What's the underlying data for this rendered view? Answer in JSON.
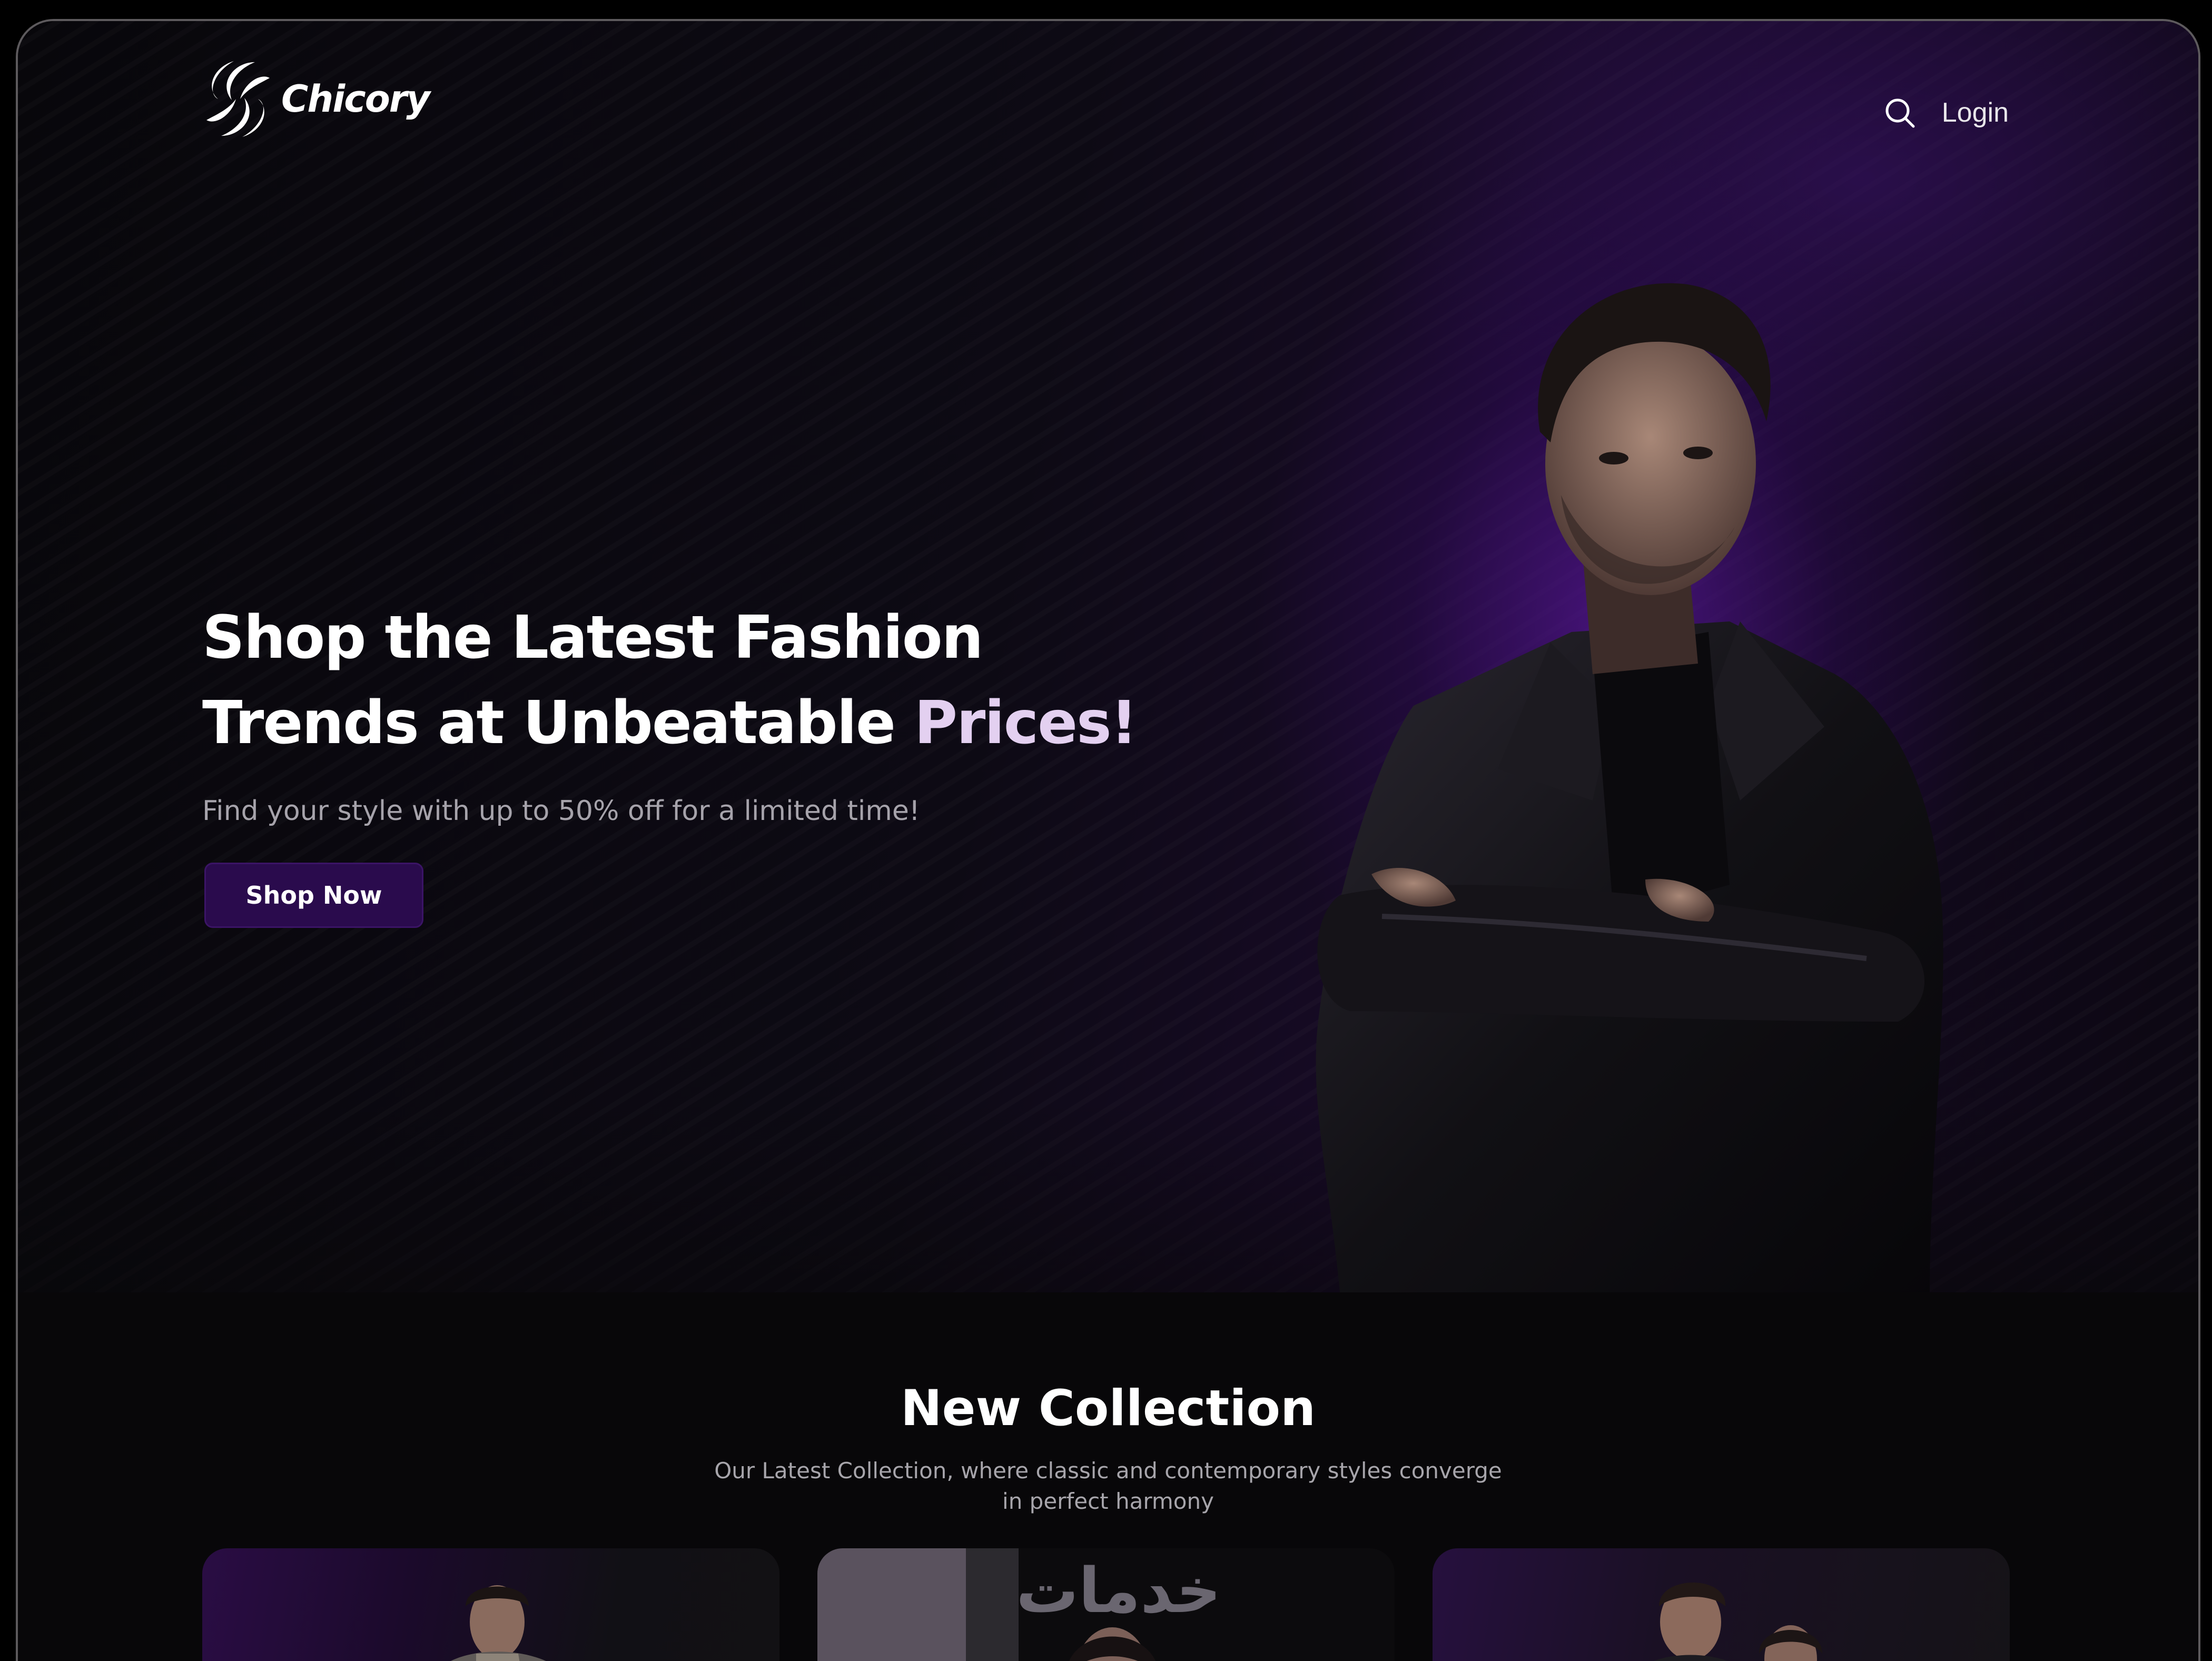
{
  "brand": {
    "name": "Chicory"
  },
  "nav": {
    "login_label": "Login"
  },
  "hero": {
    "headline_line1": "Shop the Latest Fashion",
    "headline_line2_a": "Trends at Unbeatable ",
    "headline_line2_b": "Prices!",
    "subtitle": "Find your style with up to 50% off for a limited time!",
    "cta_label": "Shop Now"
  },
  "collection": {
    "title": "New Collection",
    "subtitle": "Our Latest Collection, where classic and contemporary styles converge in perfect harmony",
    "cards": [
      {
        "image": "man-in-hoodie"
      },
      {
        "image": "woman-portrait",
        "overlay_text": "خدمات"
      },
      {
        "image": "couple-portrait"
      }
    ]
  },
  "colors": {
    "accent": "#2a0b4d",
    "hero_glow": "#561696",
    "background": "#080709"
  }
}
